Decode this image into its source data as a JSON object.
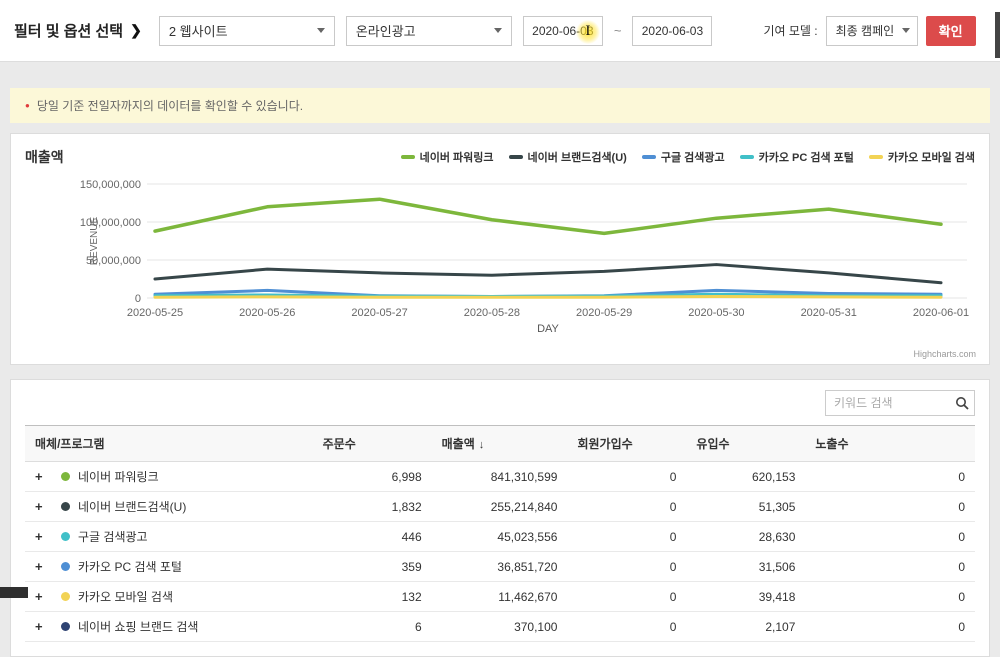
{
  "filter_bar": {
    "title": "필터 및 옵션 선택",
    "title_arrow": "❯",
    "site_select": "2 웹사이트",
    "channel_select": "온라인광고",
    "date_from": "2020-06-03",
    "date_separator": "~",
    "date_to": "2020-06-03",
    "attribution_label": "기여 모델 :",
    "attribution_select": "최종 캠페인",
    "confirm_button": "확인",
    "cursor_glyph": "I"
  },
  "notice": {
    "bullet": "●",
    "text": "당일 기준 전일자까지의 데이터를 확인할 수 있습니다."
  },
  "chart_panel": {
    "title": "매출액",
    "credit": "Highcharts.com"
  },
  "chart_data": {
    "type": "line",
    "title": "매출액",
    "xlabel": "DAY",
    "ylabel": "REVENUE",
    "ylim": [
      0,
      150000000
    ],
    "yticks": [
      "150,000,000",
      "100,000,000",
      "50,000,000",
      "0"
    ],
    "grid": true,
    "legend_position": "top-right",
    "x": [
      "2020-05-25",
      "2020-05-26",
      "2020-05-27",
      "2020-05-28",
      "2020-05-29",
      "2020-05-30",
      "2020-05-31",
      "2020-06-01"
    ],
    "series": [
      {
        "name": "네이버 파워링크",
        "color": "#7db73c",
        "values": [
          88000000,
          120000000,
          130000000,
          103000000,
          85000000,
          105000000,
          117000000,
          97000000
        ]
      },
      {
        "name": "네이버 브랜드검색(U)",
        "color": "#374649",
        "values": [
          25000000,
          38000000,
          33000000,
          30000000,
          35000000,
          44000000,
          33000000,
          20000000
        ]
      },
      {
        "name": "구글 검색광고",
        "color": "#4f8fd4",
        "values": [
          5000000,
          10000000,
          3000000,
          2000000,
          3000000,
          10000000,
          6000000,
          5000000
        ]
      },
      {
        "name": "카카오 PC 검색 포털",
        "color": "#41c0c8",
        "values": [
          3000000,
          4000000,
          2500000,
          2000000,
          2500000,
          5000000,
          3000000,
          3000000
        ]
      },
      {
        "name": "카카오 모바일 검색",
        "color": "#f2d355",
        "values": [
          1000000,
          1500000,
          1000000,
          1000000,
          1000000,
          2000000,
          1500000,
          1000000
        ]
      }
    ]
  },
  "table": {
    "search_placeholder": "키워드 검색",
    "expand_symbol": "+",
    "sort_indicator": "↓",
    "columns": [
      {
        "label": "매체/프로그램",
        "sorted": false
      },
      {
        "label": "주문수",
        "sorted": false
      },
      {
        "label": "매출액",
        "sorted": true
      },
      {
        "label": "회원가입수",
        "sorted": false
      },
      {
        "label": "유입수",
        "sorted": false
      },
      {
        "label": "노출수",
        "sorted": false
      }
    ],
    "rows": [
      {
        "name": "네이버 파워링크",
        "color": "#7db73c",
        "orders": "6,998",
        "revenue": "841,310,599",
        "signups": "0",
        "inflow": "620,153",
        "impressions": "0"
      },
      {
        "name": "네이버 브랜드검색(U)",
        "color": "#374649",
        "orders": "1,832",
        "revenue": "255,214,840",
        "signups": "0",
        "inflow": "51,305",
        "impressions": "0"
      },
      {
        "name": "구글 검색광고",
        "color": "#41c0c8",
        "orders": "446",
        "revenue": "45,023,556",
        "signups": "0",
        "inflow": "28,630",
        "impressions": "0"
      },
      {
        "name": "카카오 PC 검색 포털",
        "color": "#4f8fd4",
        "orders": "359",
        "revenue": "36,851,720",
        "signups": "0",
        "inflow": "31,506",
        "impressions": "0"
      },
      {
        "name": "카카오 모바일 검색",
        "color": "#f2d355",
        "orders": "132",
        "revenue": "11,462,670",
        "signups": "0",
        "inflow": "39,418",
        "impressions": "0"
      },
      {
        "name": "네이버 쇼핑 브랜드 검색",
        "color": "#2e4372",
        "orders": "6",
        "revenue": "370,100",
        "signups": "0",
        "inflow": "2,107",
        "impressions": "0"
      }
    ]
  }
}
